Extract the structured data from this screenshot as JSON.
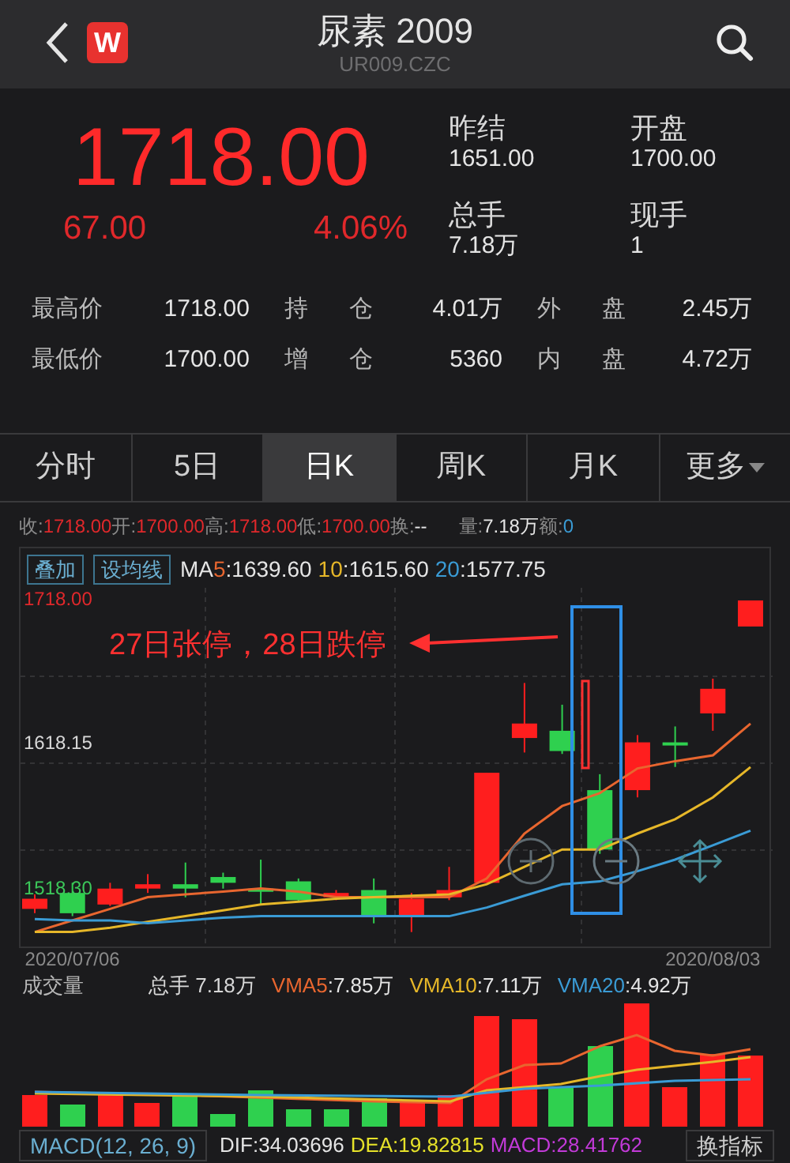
{
  "header": {
    "title": "尿素 2009",
    "code": "UR009.CZC",
    "logo": "W"
  },
  "quote": {
    "price": "1718.00",
    "change": "67.00",
    "percent": "4.06%",
    "fields": [
      {
        "label": "昨结",
        "value": "1651.00"
      },
      {
        "label": "开盘",
        "value": "1700.00"
      },
      {
        "label": "总手",
        "value": "7.18万"
      },
      {
        "label": "现手",
        "value": "1"
      }
    ]
  },
  "stats": [
    [
      {
        "label": "最高价",
        "value": "1718.00"
      },
      {
        "label": "持仓",
        "value": "4.01万"
      },
      {
        "label": "外盘",
        "value": "2.45万"
      }
    ],
    [
      {
        "label": "最低价",
        "value": "1700.00"
      },
      {
        "label": "增仓",
        "value": "5360"
      },
      {
        "label": "内盘",
        "value": "4.72万"
      }
    ]
  ],
  "tabs": [
    {
      "label": "分时",
      "selected": false
    },
    {
      "label": "5日",
      "selected": false
    },
    {
      "label": "日K",
      "selected": true
    },
    {
      "label": "周K",
      "selected": false
    },
    {
      "label": "月K",
      "selected": false
    },
    {
      "label": "更多",
      "selected": false,
      "dropdown": true
    }
  ],
  "info_line": [
    {
      "label": "收:",
      "value": "1718.00",
      "color": "#e0282b"
    },
    {
      "label": "开:",
      "value": "1700.00",
      "color": "#e0282b"
    },
    {
      "label": "高:",
      "value": "1718.00",
      "color": "#e0282b"
    },
    {
      "label": "低:",
      "value": "1700.00",
      "color": "#e0282b"
    },
    {
      "label": "换:",
      "value": "--",
      "color": "#e5e5e5"
    },
    {
      "label": "量:",
      "value": "7.18万",
      "color": "#e5e5e5"
    },
    {
      "label": "额:",
      "value": "0",
      "color": "#3a9bd5"
    }
  ],
  "chart": {
    "buttons": [
      "叠加",
      "设均线"
    ],
    "ma_legend": [
      {
        "prefix": "MA",
        "period": "5",
        "value": ":1639.60"
      },
      {
        "period": "10",
        "value": ":1615.60"
      },
      {
        "period": "20",
        "value": ":1577.75"
      }
    ],
    "annotation": "27日张停，28日跌停",
    "chart_data": {
      "type": "candlestick",
      "categories": [
        null,
        "2020/07/06",
        null,
        null,
        null,
        null,
        null,
        null,
        null,
        null,
        null,
        null,
        null,
        null,
        null,
        null,
        null,
        null,
        "2020/08/03",
        null
      ],
      "ohlc": [
        [
          1505,
          1515,
          1502,
          1512
        ],
        [
          1516,
          1523,
          1500,
          1502
        ],
        [
          1508,
          1523,
          1507,
          1519
        ],
        [
          1519,
          1529,
          1516,
          1522
        ],
        [
          1522,
          1537,
          1513,
          1519
        ],
        [
          1527,
          1530,
          1519,
          1523
        ],
        [
          1519,
          1539,
          1508,
          1517
        ],
        [
          1524,
          1526,
          1510,
          1511
        ],
        [
          1513,
          1518,
          1511,
          1516
        ],
        [
          1518,
          1526,
          1495,
          1500
        ],
        [
          1500,
          1516,
          1489,
          1512
        ],
        [
          1513,
          1534,
          1511,
          1518
        ],
        [
          1523,
          1599,
          1523,
          1599
        ],
        [
          1623,
          1661,
          1613,
          1633
        ],
        [
          1628,
          1646,
          1612,
          1614
        ],
        [
          1587,
          1598,
          1543,
          1546
        ],
        [
          1587,
          1625,
          1582,
          1620
        ],
        [
          1620,
          1631,
          1603,
          1618
        ],
        [
          1640,
          1664,
          1628,
          1657
        ],
        [
          1700,
          1718,
          1700,
          1718
        ]
      ],
      "series": [
        {
          "type": "line",
          "color": "#e8662f",
          "values": [
            1489,
            1497,
            1505,
            1513,
            1515,
            1517,
            1519,
            1517,
            1513,
            1513,
            1513,
            1513,
            1526,
            1557,
            1576,
            1585,
            1602,
            1607,
            1611,
            1633
          ]
        },
        {
          "type": "line",
          "color": "#e6b729",
          "values": [
            1489,
            1489,
            1492,
            1496,
            1500,
            1504,
            1508,
            1510,
            1512,
            1513,
            1514,
            1515,
            1522,
            1534,
            1546,
            1546,
            1557,
            1567,
            1582,
            1603
          ]
        },
        {
          "type": "line",
          "color": "#3a9bd5",
          "values": [
            1498,
            1497,
            1497,
            1495,
            1497,
            1499,
            1500,
            1500,
            1500,
            1500,
            1500,
            1500,
            1506,
            1514,
            1522,
            1524,
            1531,
            1539,
            1549,
            1559
          ]
        }
      ],
      "ylim": [
        1479,
        1754
      ],
      "yticks": [
        {
          "value": 1718,
          "label": "1718.00"
        },
        {
          "value": 1618.15,
          "label": "1618.15"
        },
        {
          "value": 1518.3,
          "label": "1518.30"
        }
      ]
    },
    "ytick_styles": [
      {
        "color": "#e0282b"
      },
      {
        "color": "#d8d8d8"
      },
      {
        "color": "#3cc85a"
      }
    ]
  },
  "volume": {
    "title": "成交量",
    "total": "总手 7.18万",
    "legend": [
      {
        "label": "VMA5",
        "value": ":7.85万",
        "color": "#e8662f"
      },
      {
        "label": "VMA10",
        "value": ":7.11万",
        "color": "#e6b729"
      },
      {
        "label": "VMA20",
        "value": ":4.92万",
        "color": "#3a9bd5"
      }
    ]
  },
  "macd": {
    "name": "MACD(12, 26, 9)",
    "values": [
      {
        "text": "DIF:34.03696",
        "color": "#e5e5e5"
      },
      {
        "text": "DEA:19.82815",
        "color": "#e6e229"
      },
      {
        "text": "MACD:28.41762",
        "color": "#c23ad8"
      }
    ],
    "button": "换指标"
  }
}
